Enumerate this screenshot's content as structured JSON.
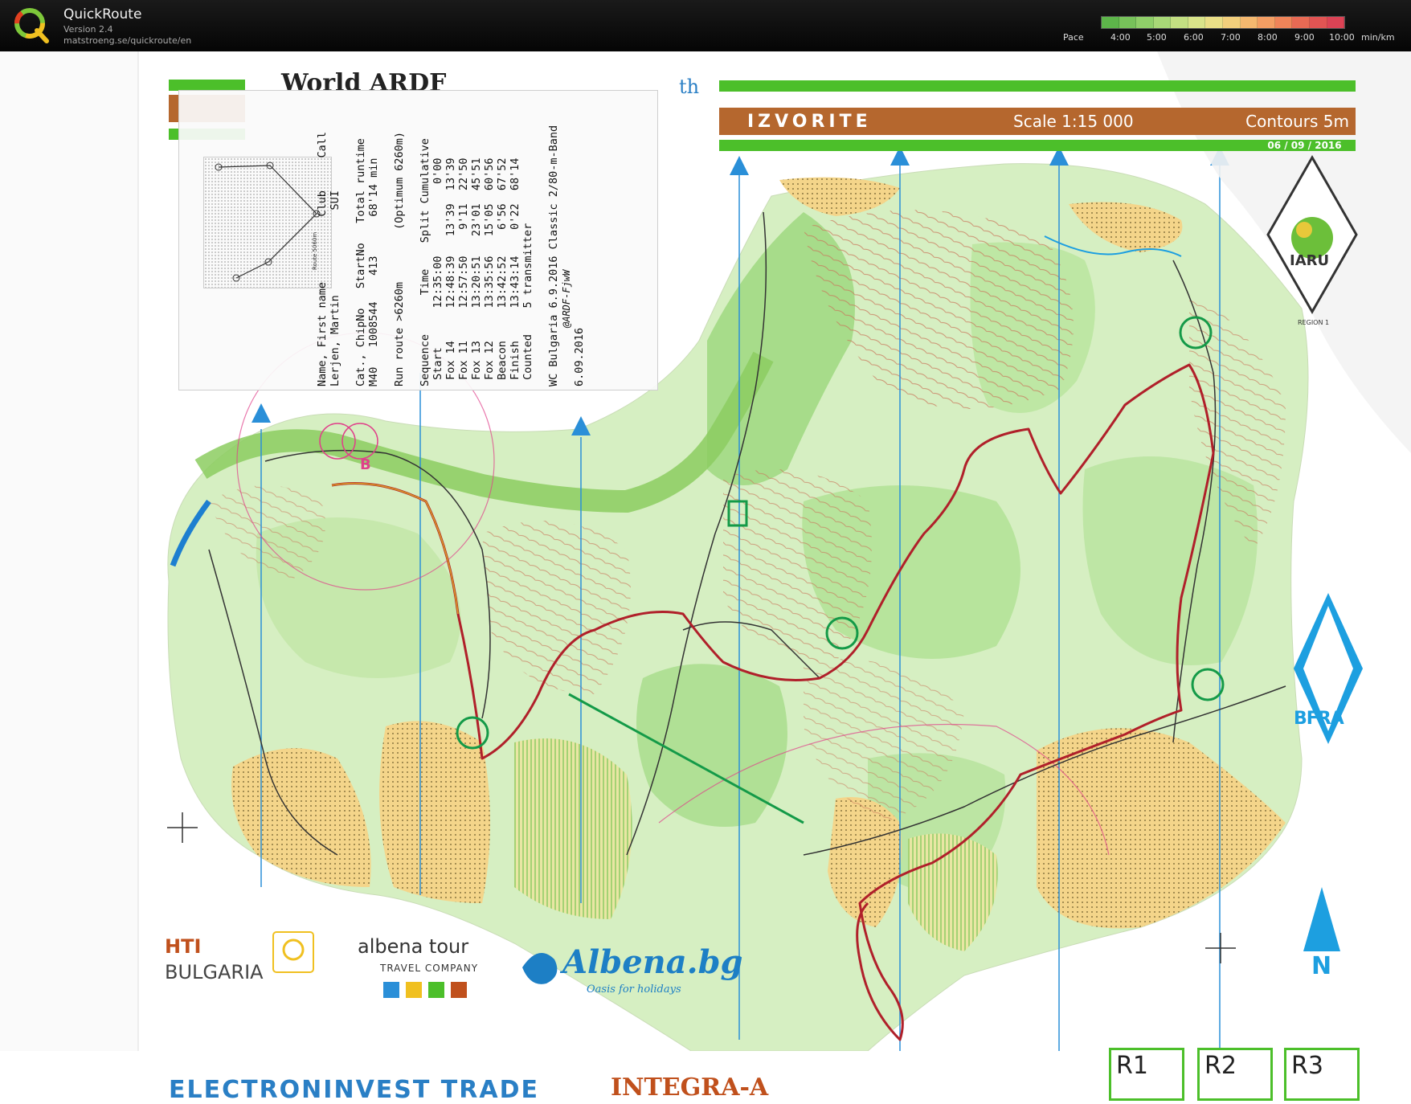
{
  "app": {
    "title": "QuickRoute",
    "version": "Version 2.4",
    "url": "matstroeng.se/quickroute/en"
  },
  "pace": {
    "label": "Pace",
    "ticks": [
      "4:00",
      "5:00",
      "6:00",
      "7:00",
      "8:00",
      "9:00",
      "10:00"
    ],
    "unit": "min/km",
    "colors": [
      "#5db54a",
      "#77c25a",
      "#8fcf69",
      "#a8d877",
      "#c3df82",
      "#d9e48a",
      "#eadf87",
      "#f2cf7c",
      "#f4b86f",
      "#f39e63",
      "#ef8459",
      "#e86a54",
      "#e25453",
      "#dc4355"
    ]
  },
  "map_header": {
    "venue": "IZVORITE",
    "scale": "Scale 1:15 000",
    "contours": "Contours 5m",
    "date": "06 / 09 / 2016",
    "event_title": "World ARDF",
    "event_sup": "th"
  },
  "slip": {
    "lines": [
      "Name, First name          Club     Call",
      "Lerjen, Martin             SUI",
      "",
      "Cat., ChipNo   StartNo   Total runtime",
      "M40   1008544    413      68'14 min",
      "",
      "Run route >6260m        (Optimum 6260m)",
      "",
      "Sequence      Time    Split Cumulative",
      " Start      12:35:00           0'00",
      " Fox 14     12:48:39   13'39  13'39",
      " Fox 11     12:57:50    9'11  22'50",
      " Fox 13     13:20:51   23'01  45'51",
      " Fox 12     13:35:56   15'05  60'56",
      " Beacon     13:42:52    6'56  67'52",
      " Finish     13:43:14    0'22  68'14",
      " Counted    5 transmitter",
      "",
      "WC Bulgaria 6.9.2016 Classic 2/80-m-Band",
      "",
      "6.09.2016"
    ],
    "side_code": "@ARDF-FjwW",
    "minimap_label": "Route 5060m"
  },
  "sponsors": {
    "hti": "HTI",
    "bulgaria": "BULGARIA",
    "albena_tour": "albena tour",
    "travel_company": "TRAVEL COMPANY",
    "albena_bg": "Albena.bg",
    "oasis": "Oasis for holidays",
    "electron": "ELECTRONINVEST TRADE",
    "integra": "INTEGRA-A"
  },
  "badges": {
    "iaru": "IARU",
    "iaru_region": "REGION 1",
    "bfra": "BFRA"
  },
  "receivers": [
    "R1",
    "R2",
    "R3"
  ]
}
